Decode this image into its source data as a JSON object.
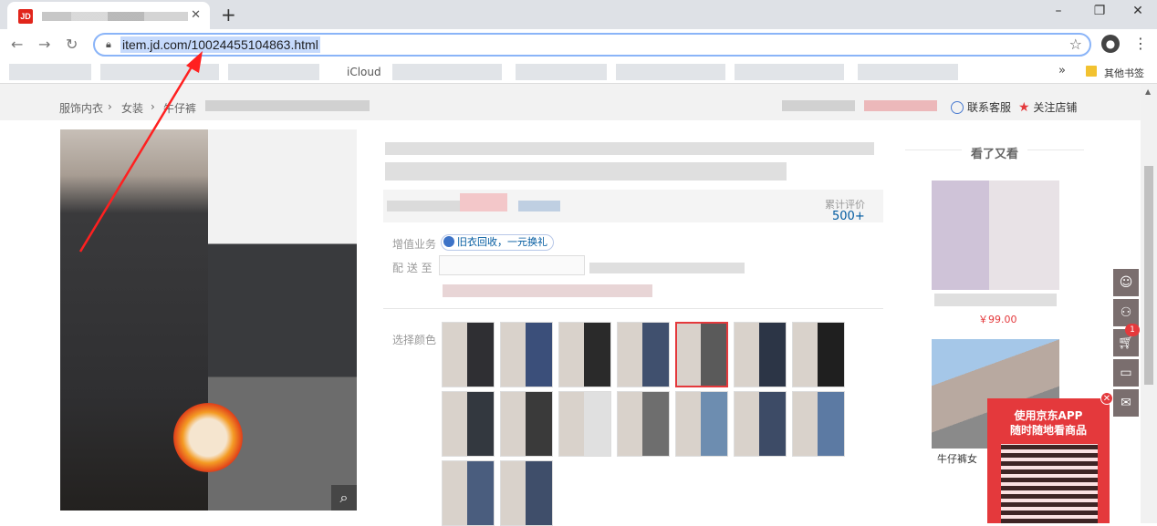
{
  "browser": {
    "tab_favicon": "JD",
    "new_tab_label": "+",
    "url": "item.jd.com/10024455104863.html",
    "bookmarks": {
      "icloud": "iCloud",
      "more": "»",
      "other_folder": "其他书签"
    },
    "window_controls": {
      "minimize": "–",
      "maximize": "❐",
      "close": "✕"
    }
  },
  "breadcrumb": {
    "items": [
      "服饰内衣",
      "女装",
      "牛仔裤"
    ],
    "separator": "›"
  },
  "shop_links": {
    "service": "联系客服",
    "follow": "关注店铺"
  },
  "product": {
    "reviews_label": "累计评价",
    "reviews_count": "500+",
    "value_added_label": "增值业务",
    "recycle_label": "旧衣回收，一元换礼",
    "delivery_label": "配 送 至",
    "color_label": "选择颜色",
    "color_swatch_count": 16,
    "selected_swatch_index": 4,
    "zoom_icon": "magnifier-icon"
  },
  "sidebar": {
    "title": "看了又看",
    "items": [
      {
        "price": "￥99.00"
      },
      {
        "caption": "牛仔裤女"
      }
    ]
  },
  "floating_toolbar": {
    "buttons": [
      "chat-icon",
      "user-icon",
      "cart-icon",
      "coupon-icon",
      "feedback-icon"
    ],
    "cart_badge": "1"
  },
  "app_ad": {
    "line1": "使用京东APP",
    "line2": "随时随地看商品",
    "close": "✕"
  },
  "colors": {
    "jd_red": "#e4393c",
    "link_blue": "#005aa0",
    "highlight": "#c6dafc"
  }
}
